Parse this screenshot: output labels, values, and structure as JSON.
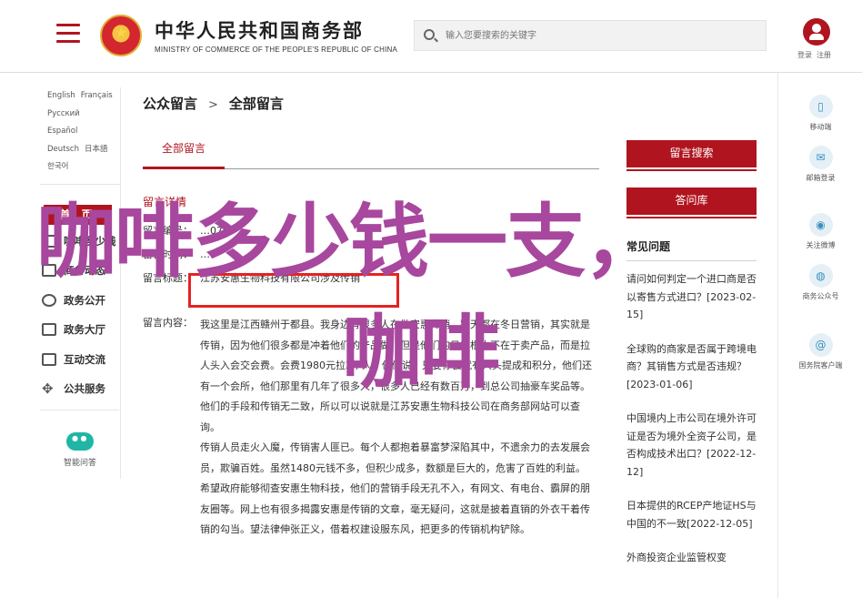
{
  "header": {
    "site_title": "中华人民共和国商务部",
    "site_subtitle": "MINISTRY OF COMMERCE OF THE PEOPLE'S REPUBLIC OF CHINA",
    "search_placeholder": "输入您要搜索的关键字",
    "login_label": "登录",
    "register_label": "注册"
  },
  "languages": [
    "English",
    "Français",
    "Русский",
    "Español",
    "Deutsch",
    "日本語",
    "한국어"
  ],
  "sidebar": {
    "home_label": "首 页",
    "items": [
      {
        "label": "咖啡多少钱"
      },
      {
        "label": "商务动态"
      },
      {
        "label": "政务公开"
      },
      {
        "label": "政务大厅"
      },
      {
        "label": "互动交流"
      },
      {
        "label": "公共服务"
      }
    ],
    "smart_qa_label": "智能问答"
  },
  "breadcrumb": {
    "parent": "公众留言",
    "current": "全部留言"
  },
  "tab": {
    "label": "全部留言"
  },
  "detail": {
    "heading": "留言详情",
    "rows": [
      {
        "label": "留言编号：",
        "value": "…07"
      },
      {
        "label": "留言时间：",
        "value": "…"
      },
      {
        "label": "留言标题：",
        "value": "江苏安惠生物科技有限公司涉及传销"
      }
    ],
    "content_label": "留言内容：",
    "paragraphs": [
      "我这里是江西赣州于都县。我身边有很多人在做安惠传销，整天都在冬日营销，其实就是传销，因为他们很多都是冲着他们的产品做，但是他们的目的根本不在于卖产品，而是拉人头入会交会费。会费1980元拉2个人，他们说：只要你会就有人头提成和积分，他们还有一个会所，他们那里有几年了很多人，很多人已经有数百万，到总公司抽豪车奖品等。他们的手段和传销无二致，所以可以说就是江苏安惠生物科技公司在商务部网站可以查询。",
      "传销人员走火入魔，传销害人匪已。每个人都抱着暴富梦深陷其中，不遗余力的去发展会员，欺骗百姓。虽然1480元钱不多，但积少成多，数额是巨大的，危害了百姓的利益。",
      "希望政府能够彻查安惠生物科技，他们的营销手段无孔不入，有网文、有电台、霸屏的朋友圈等。网上也有很多揭露安惠是传销的文章，毫无疑问，这就是披着直销的外衣干着传销的勾当。望法律伸张正义，借着权建设服东风，把更多的传销机构铲除。"
    ]
  },
  "right": {
    "search_btn": "留言搜索",
    "qa_btn": "答问库",
    "faq_title": "常见问题",
    "faq": [
      "请问如何判定一个进口商是否以寄售方式进口？[2023-02-15]",
      "全球购的商家是否属于跨境电商？其销售方式是否违规？[2023-01-06]",
      "中国境内上市公司在境外许可证是否为境外全资子公司，是否构成技术出口？[2022-12-12]",
      "日本提供的RCEP产地证HS与中国的不一致[2022-12-05]",
      "外商投资企业监管权变"
    ]
  },
  "far_right": [
    {
      "label": "移动端",
      "icon": "mobile-icon"
    },
    {
      "label": "邮箱登录",
      "icon": "mail-icon"
    },
    {
      "label": "关注微博",
      "icon": "weibo-icon"
    },
    {
      "label": "商务公众号",
      "icon": "wechat-icon"
    },
    {
      "label": "国务院客户端",
      "icon": "at-icon"
    }
  ],
  "overlay": {
    "line1": "咖啡多少钱一支，",
    "line2": "咖啡"
  },
  "colors": {
    "brand_red": "#b0151f",
    "overlay_purple": "#a8479e",
    "highlight_red": "#e52222"
  }
}
